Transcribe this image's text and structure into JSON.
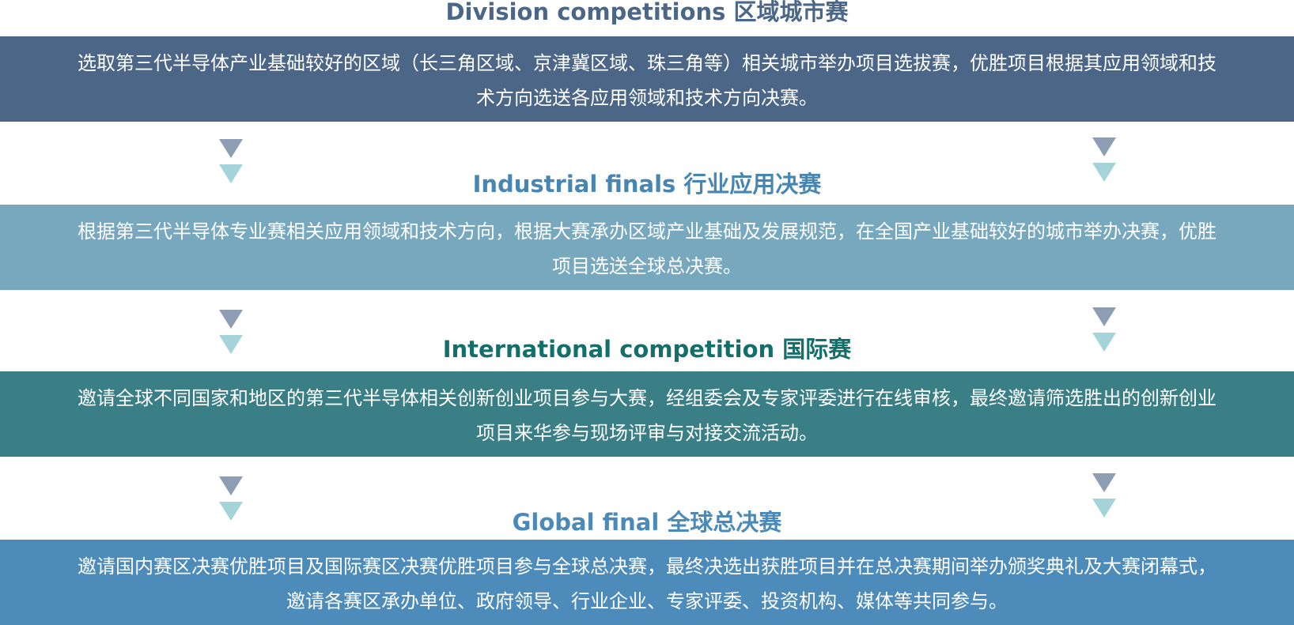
{
  "stages": [
    {
      "title": "Division competitions 区域城市赛",
      "description": "选取第三代半导体产业基础较好的区域（长三角区域、京津冀区域、珠三角等）相关城市举办项目选拔赛，优胜项目根据其应用领域和技术方向选送各应用领域和技术方向决赛。"
    },
    {
      "title": "Industrial finals 行业应用决赛",
      "description": "根据第三代半导体专业赛相关应用领域和技术方向，根据大赛承办区域产业基础及发展规范，在全国产业基础较好的城市举办决赛，优胜项目选送全球总决赛。"
    },
    {
      "title": "International competition 国际赛",
      "description": "邀请全球不同国家和地区的第三代半导体相关创新创业项目参与大赛，经组委会及专家评委进行在线审核，最终邀请筛选胜出的创新创业项目来华参与现场评审与对接交流活动。"
    },
    {
      "title": "Global final  全球总决赛",
      "description": "邀请国内赛区决赛优胜项目及国际赛区决赛优胜项目参与全球总决赛，最终决选出获胜项目并在总决赛期间举办颁奖典礼及大赛闭幕式，邀请各赛区承办单位、政府领导、行业企业、专家评委、投资机构、媒体等共同参与。"
    }
  ],
  "colors": {
    "stage_1_title": "#4b6687",
    "stage_1_box": "#4b6687",
    "stage_2_title": "#4786b2",
    "stage_2_box": "#78a8bd",
    "stage_3_title": "#146f6b",
    "stage_3_box": "#3a7f86",
    "stage_4_title": "#4b8ab8",
    "stage_4_box": "#4d8bba",
    "arrow_top": "#8d9db3",
    "arrow_bottom": "#a5d3da"
  },
  "icons": {
    "connector": "double-down-triangle-icon"
  }
}
